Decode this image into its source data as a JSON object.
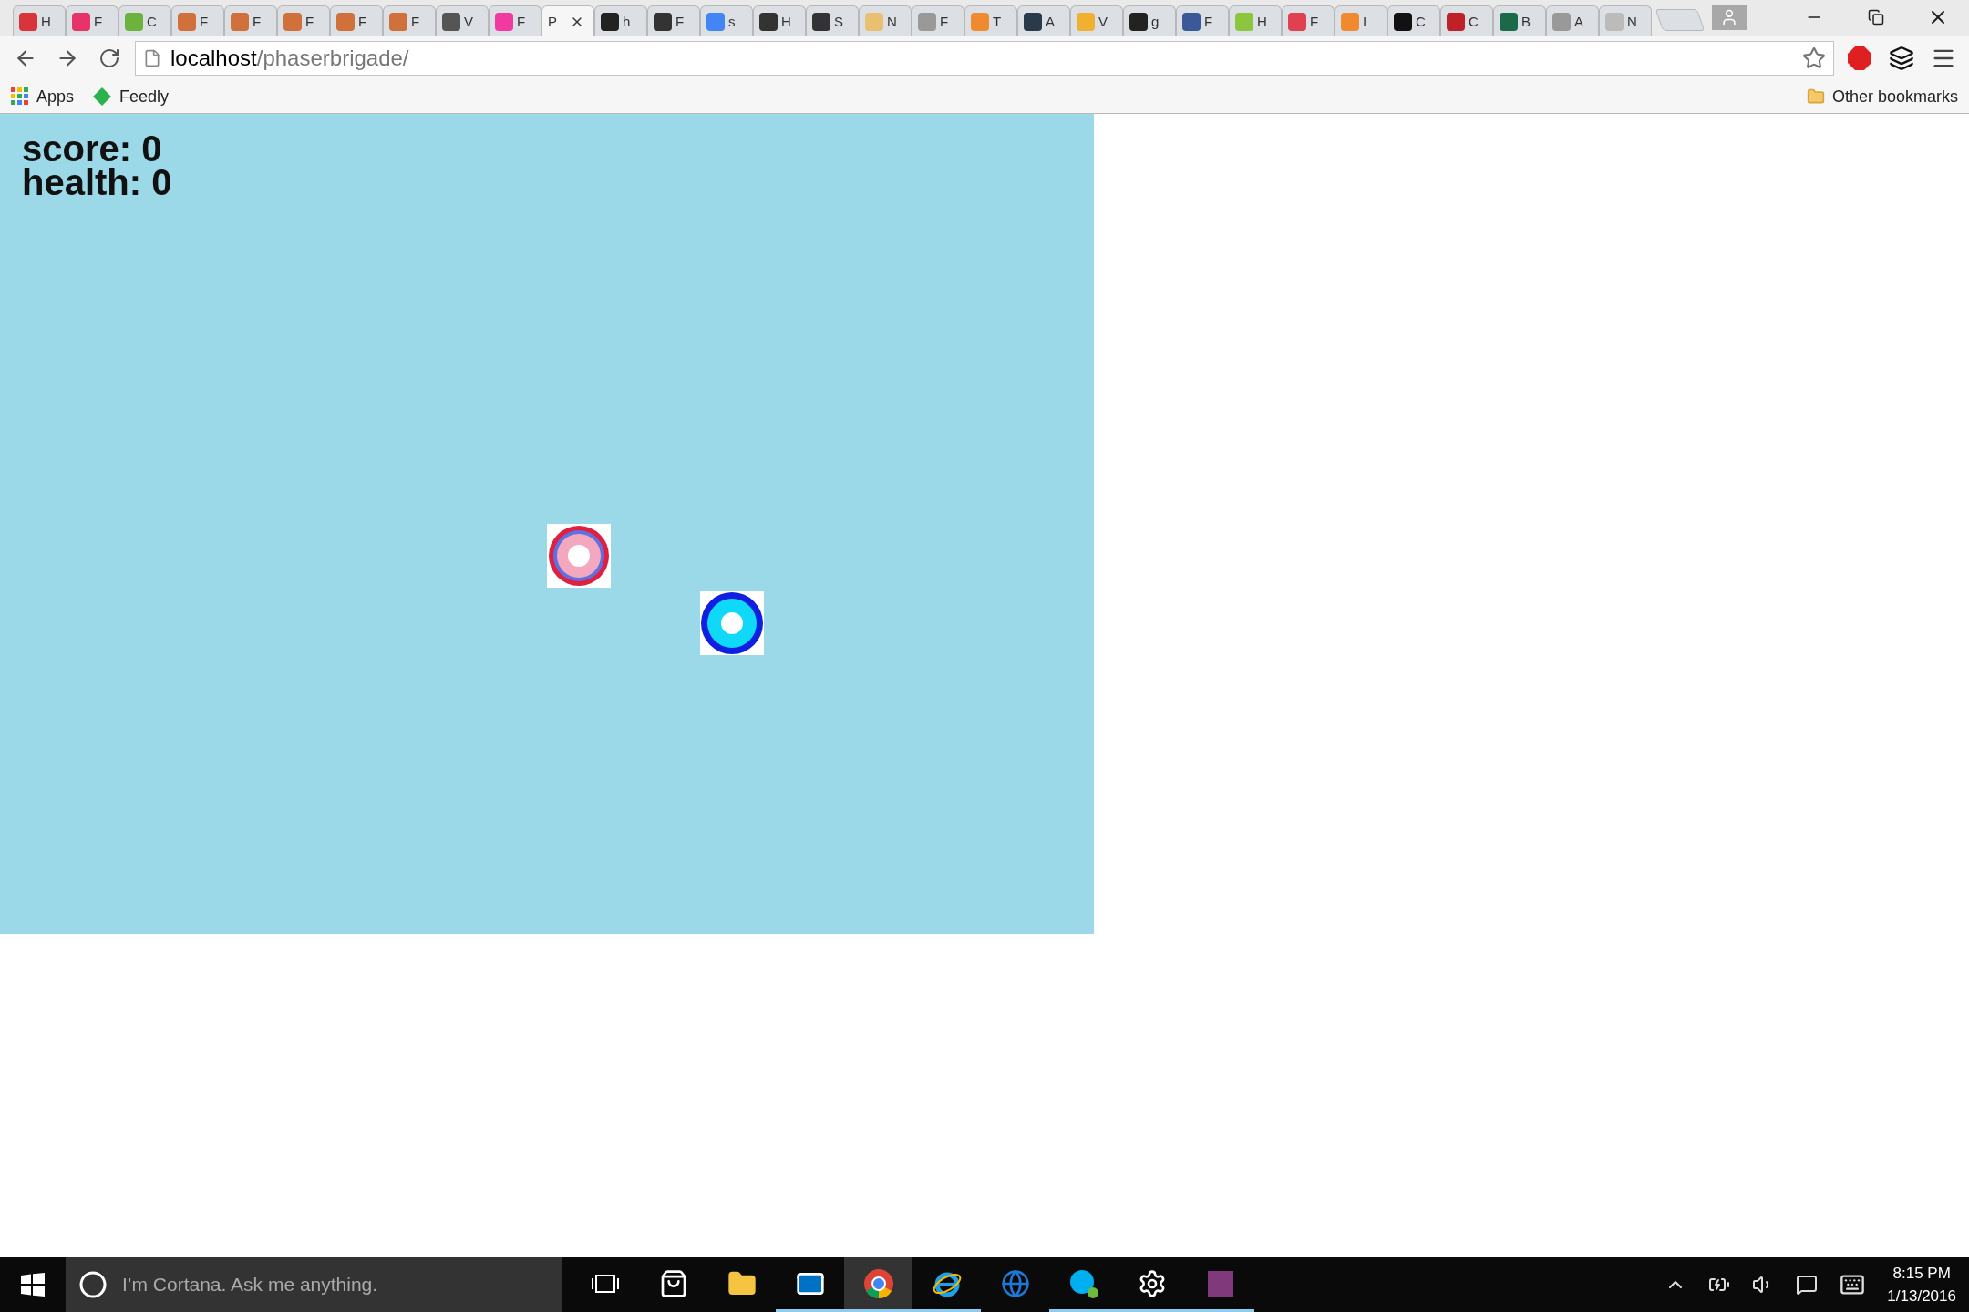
{
  "tabs": [
    {
      "letter": "H",
      "color": "#d9343a",
      "selected": false
    },
    {
      "letter": "F",
      "color": "#e8336a",
      "selected": false
    },
    {
      "letter": "C",
      "color": "#6cb33e",
      "selected": false
    },
    {
      "letter": "F",
      "color": "#d0703a",
      "selected": false
    },
    {
      "letter": "F",
      "color": "#d0703a",
      "selected": false
    },
    {
      "letter": "F",
      "color": "#d0703a",
      "selected": false
    },
    {
      "letter": "F",
      "color": "#d0703a",
      "selected": false
    },
    {
      "letter": "F",
      "color": "#d0703a",
      "selected": false
    },
    {
      "letter": "V",
      "color": "#555555",
      "selected": false
    },
    {
      "letter": "F",
      "color": "#f03aa0",
      "selected": false
    },
    {
      "letter": "P",
      "selected": true
    },
    {
      "letter": "h",
      "color": "#222222",
      "selected": false
    },
    {
      "letter": "F",
      "color": "#333333",
      "selected": false
    },
    {
      "letter": "s",
      "color": "#4285f4",
      "selected": false
    },
    {
      "letter": "H",
      "color": "#333333",
      "selected": false
    },
    {
      "letter": "S",
      "color": "#333333",
      "selected": false
    },
    {
      "letter": "N",
      "color": "#e8c070",
      "selected": false
    },
    {
      "letter": "F",
      "color": "#999999",
      "selected": false
    },
    {
      "letter": "T",
      "color": "#f08a30",
      "selected": false
    },
    {
      "letter": "A",
      "color": "#2a3a4a",
      "selected": false
    },
    {
      "letter": "V",
      "color": "#f0b030",
      "selected": false
    },
    {
      "letter": "g",
      "color": "#222222",
      "selected": false
    },
    {
      "letter": "F",
      "color": "#3b5998",
      "selected": false
    },
    {
      "letter": "H",
      "color": "#8cc63e",
      "selected": false
    },
    {
      "letter": "F",
      "color": "#e04050",
      "selected": false
    },
    {
      "letter": "I",
      "color": "#f08a30",
      "selected": false
    },
    {
      "letter": "C",
      "color": "#111111",
      "selected": false
    },
    {
      "letter": "C",
      "color": "#c02028",
      "selected": false
    },
    {
      "letter": "B",
      "color": "#1a6a4a",
      "selected": false
    },
    {
      "letter": "A",
      "color": "#999999",
      "selected": false
    },
    {
      "letter": "N",
      "color": "#bbbbbb",
      "selected": false
    }
  ],
  "address": {
    "host": "localhost",
    "path": "/phaserbrigade/"
  },
  "bookmarks": [
    {
      "label": "Apps"
    },
    {
      "label": "Feedly"
    }
  ],
  "other_bookmarks": "Other bookmarks",
  "game": {
    "score": "score: 0",
    "health": "health: 0"
  },
  "taskbar": {
    "search_placeholder": "I’m Cortana. Ask me anything.",
    "apps": [
      {
        "kind": "taskview",
        "running": false,
        "active": false
      },
      {
        "kind": "store",
        "running": false,
        "active": false
      },
      {
        "kind": "explorer",
        "running": false,
        "active": false
      },
      {
        "kind": "outlook",
        "running": true,
        "active": false
      },
      {
        "kind": "chrome",
        "running": true,
        "active": true
      },
      {
        "kind": "ie",
        "running": true,
        "active": false
      },
      {
        "kind": "edge",
        "running": false,
        "active": false
      },
      {
        "kind": "skype",
        "running": true,
        "active": false
      },
      {
        "kind": "settings",
        "running": true,
        "active": false
      },
      {
        "kind": "onenote",
        "running": true,
        "active": false
      }
    ],
    "time": "8:15 PM",
    "date": "1/13/2016"
  }
}
